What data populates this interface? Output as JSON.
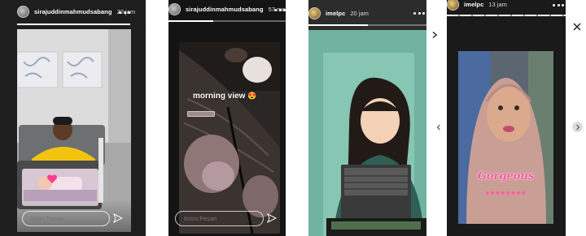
{
  "stories": [
    {
      "username": "sirajuddinmahmudsabang",
      "time": "22 jam",
      "reply_placeholder": "Kirim Pesan"
    },
    {
      "username": "sirajuddinmahmudsabang",
      "time": "57 menit",
      "sticker_text": "morning view",
      "sticker_emoji": "😍",
      "reply_placeholder": "Kirim Pesan"
    },
    {
      "username": "imelpc",
      "time": "20 jam"
    },
    {
      "username": "imelpc",
      "time": "13 jam",
      "sticker_text": "Gorgeous",
      "sticker_hearts": "♥♥♥♥♥♥♥♥"
    }
  ],
  "icons": {
    "close": "close-icon",
    "send": "send-icon",
    "more": "more-options-icon",
    "next": "chevron-right-icon",
    "prev": "chevron-left-icon"
  },
  "colors": {
    "story1_bg": "#1e1e1e",
    "story2_bg": "#141414",
    "story3_bg": "#2c2c2c",
    "story4_bg": "#1a1a1a",
    "accent_pink": "#ff3d8b"
  }
}
